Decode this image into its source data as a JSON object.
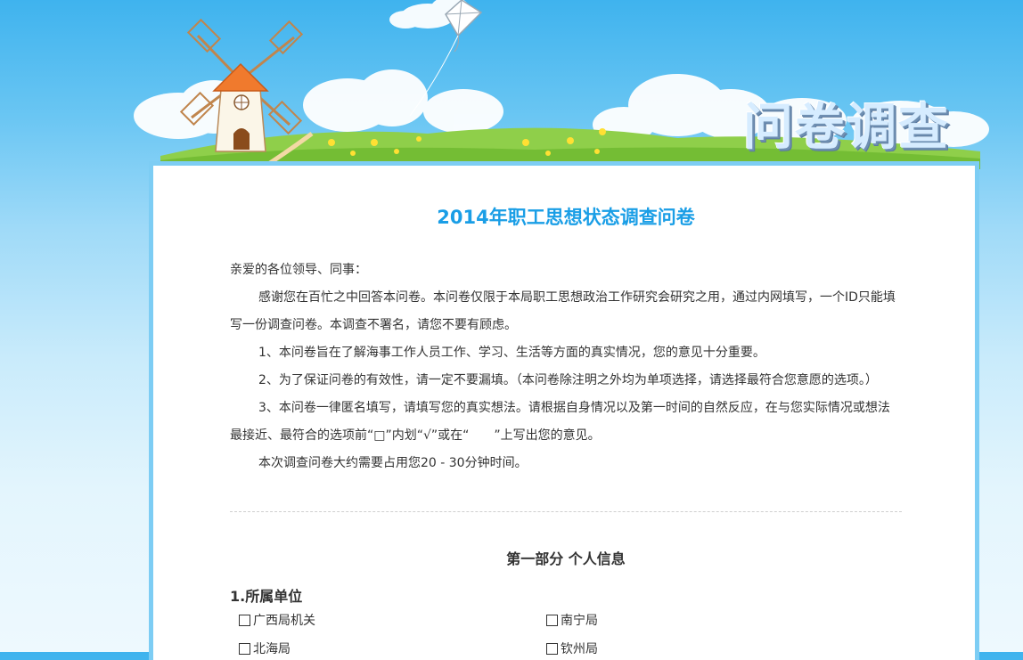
{
  "header": {
    "banner_title": "问卷调查"
  },
  "survey": {
    "title": "2014年职工思想状态调查问卷",
    "intro": [
      {
        "text": "亲爱的各位领导、同事：",
        "indent": false
      },
      {
        "text": "感谢您在百忙之中回答本问卷。本问卷仅限于本局职工思想政治工作研究会研究之用，通过内网填写，一个ID只能填写一份调查问卷。本调查不署名，请您不要有顾虑。",
        "indent": true
      },
      {
        "text": "1、本问卷旨在了解海事工作人员工作、学习、生活等方面的真实情况，您的意见十分重要。",
        "indent": true
      },
      {
        "text": "2、为了保证问卷的有效性，请一定不要漏填。（本问卷除注明之外均为单项选择，请选择最符合您意愿的选项。）",
        "indent": true
      },
      {
        "text": "3、本问卷一律匿名填写，请填写您的真实想法。请根据自身情况以及第一时间的自然反应，在与您实际情况或想法最接近、最符合的选项前“□”内划“√”或在“　　”上写出您的意见。",
        "indent": true
      },
      {
        "text": "本次调查问卷大约需要占用您20 - 30分钟时间。",
        "indent": true
      }
    ],
    "section_title": "第一部分 个人信息",
    "question1": {
      "title": "1.所属单位",
      "options": [
        "广西局机关",
        "南宁局",
        "北海局",
        "钦州局"
      ]
    }
  },
  "colors": {
    "accent": "#1a9ee6",
    "card_border": "#7dcdf4"
  }
}
